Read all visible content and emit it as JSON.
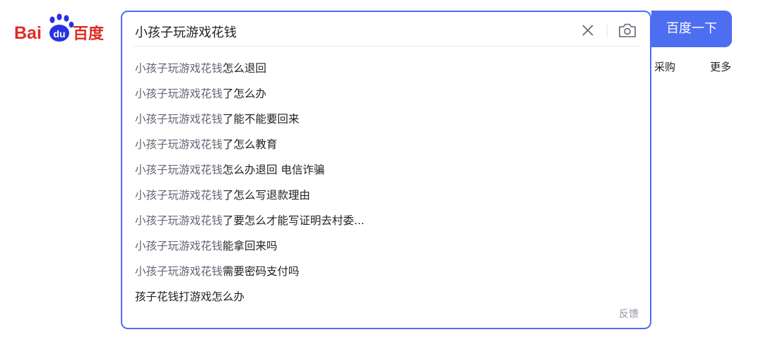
{
  "search": {
    "query": "小孩子玩游戏花钱",
    "button_label": "百度一下",
    "feedback_label": "反馈",
    "suggestions": [
      {
        "prefix": "小孩子玩游戏花钱",
        "suffix": "怎么退回"
      },
      {
        "prefix": "小孩子玩游戏花钱",
        "suffix": "了怎么办"
      },
      {
        "prefix": "小孩子玩游戏花钱",
        "suffix": "了能不能要回来"
      },
      {
        "prefix": "小孩子玩游戏花钱",
        "suffix": "了怎么教育"
      },
      {
        "prefix": "小孩子玩游戏花钱",
        "suffix": "怎么办退回 电信诈骗"
      },
      {
        "prefix": "小孩子玩游戏花钱",
        "suffix": "了怎么写退款理由"
      },
      {
        "prefix": "小孩子玩游戏花钱",
        "suffix": "了要怎么才能写证明去村委..."
      },
      {
        "prefix": "小孩子玩游戏花钱",
        "suffix": "能拿回来吗"
      },
      {
        "prefix": "小孩子玩游戏花钱",
        "suffix": "需要密码支付吗"
      },
      {
        "prefix": "",
        "suffix": "孩子花钱打游戏怎么办"
      }
    ]
  },
  "nav": {
    "cg_label": "采购",
    "more_label": "更多"
  },
  "logo": {
    "left_text": "Bai",
    "paw_text": "du",
    "right_text": "百度"
  },
  "colors": {
    "brand_blue": "#4e6ef2",
    "logo_red": "#de2c24",
    "logo_blue": "#2932e1",
    "suggestion_prefix": "#626675"
  },
  "icons": [
    "baidu-paw-icon",
    "clear-icon",
    "camera-icon"
  ]
}
